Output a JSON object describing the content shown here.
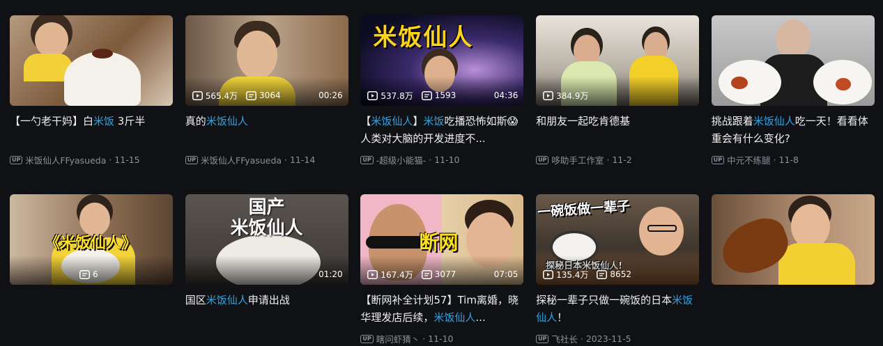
{
  "videos": [
    {
      "title_parts": [
        "【一勺老干妈】白",
        "米饭",
        " 3斤半"
      ],
      "stats": {
        "views": "",
        "danmaku": ""
      },
      "duration": "",
      "author": "米饭仙人FFyasueda",
      "date": "11-15",
      "thumb_text": ""
    },
    {
      "title_parts": [
        "真的",
        "米饭仙人",
        ""
      ],
      "stats": {
        "views": "565.4万",
        "danmaku": "3064"
      },
      "duration": "00:26",
      "author": "米饭仙人FFyasueda",
      "date": "11-14",
      "thumb_text": ""
    },
    {
      "title_parts": [
        "【",
        "米饭仙人",
        "】",
        "米饭",
        "吃播恐怖如斯😱人类对大脑的开发进度不..."
      ],
      "stats": {
        "views": "537.8万",
        "danmaku": "1593"
      },
      "duration": "04:36",
      "author": "-超级小能猫-",
      "date": "11-10",
      "thumb_text": "米饭仙人"
    },
    {
      "title_parts": [
        "和朋友一起吃肯德基",
        "",
        ""
      ],
      "stats": {
        "views": "384.9万",
        "danmaku": ""
      },
      "duration": "",
      "author": "哆助手工作室",
      "date": "11-2",
      "thumb_text": ""
    },
    {
      "title_parts": [
        "挑战跟着",
        "米饭仙人",
        "吃一天！看看体重会有什么变化?"
      ],
      "stats": {
        "views": "",
        "danmaku": ""
      },
      "duration": "",
      "author": "中元不练腿",
      "date": "11-8",
      "thumb_text": ""
    },
    {
      "title_parts": [
        "",
        "",
        ""
      ],
      "stats": {
        "views": "",
        "danmaku": "6"
      },
      "duration": "",
      "author": "",
      "date": "",
      "thumb_text": "《米饭仙人》"
    },
    {
      "title_parts": [
        "国区",
        "米饭仙人",
        "申请出战"
      ],
      "stats": {
        "views": "",
        "danmaku": ""
      },
      "duration": "01:20",
      "author": "",
      "date": "",
      "thumb_text": "国产\n米饭仙人"
    },
    {
      "title_parts": [
        "【断网补全计划57】Tim离婚，晓华理发店后续，",
        "米饭仙人",
        "..."
      ],
      "stats": {
        "views": "167.4万",
        "danmaku": "3077"
      },
      "duration": "07:05",
      "author": "瞎问虾猜丶",
      "date": "11-10",
      "thumb_text": "断网"
    },
    {
      "title_parts": [
        "探秘一辈子只做一碗饭的日本",
        "米饭仙人",
        "！"
      ],
      "stats": {
        "views": "135.4万",
        "danmaku": "8652"
      },
      "duration": "",
      "author": "飞社长",
      "date": "2023-11-5",
      "thumb_text": "一碗饭做一辈子|探秘日本米饭仙人!"
    },
    {
      "title_parts": [
        "",
        "",
        ""
      ],
      "stats": {
        "views": "",
        "danmaku": ""
      },
      "duration": "",
      "author": "",
      "date": "",
      "thumb_text": ""
    }
  ],
  "colors": {
    "highlight": "#2fa3e6",
    "background": "#0f1115",
    "meta": "#8e9197"
  },
  "icons": {
    "play": "play-icon",
    "danmaku": "danmaku-icon",
    "up_badge": "UP"
  }
}
